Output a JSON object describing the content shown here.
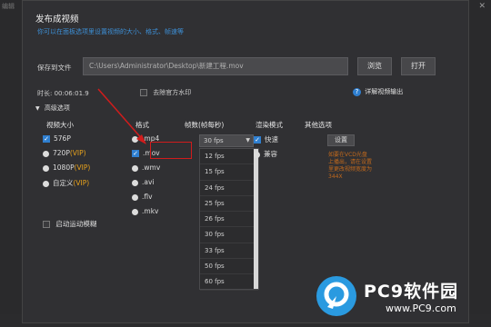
{
  "background": {
    "left_label": "编辑"
  },
  "dialog": {
    "title": "发布成视频",
    "subtitle": "你可以在面板选项里设置视频的大小、格式、帧速等",
    "save_label": "保存到文件",
    "path_value": "C:\\Users\\Administrator\\Desktop\\新建工程.mov",
    "browse_label": "浏览",
    "open_label": "打开",
    "duration": "时长: 00:06:01.9",
    "watermark_label": "去除官方水印",
    "help_label": "详解视频输出",
    "advanced_label": "高级选项",
    "columns": {
      "size": "视频大小",
      "format": "格式",
      "fps": "帧数(帧每秒)",
      "render": "渲染模式",
      "other": "其他选项"
    },
    "sizes": [
      {
        "label": "576P",
        "vip": "",
        "selected": true
      },
      {
        "label": "720P",
        "vip": "(VIP)",
        "selected": false
      },
      {
        "label": "1080P",
        "vip": "(VIP)",
        "selected": false
      },
      {
        "label": "自定义",
        "vip": "(VIP)",
        "selected": false
      }
    ],
    "formats": [
      {
        "label": ".mp4",
        "selected": false
      },
      {
        "label": ".mov",
        "selected": true
      },
      {
        "label": ".wmv",
        "selected": false
      },
      {
        "label": ".avi",
        "selected": false
      },
      {
        "label": ".flv",
        "selected": false
      },
      {
        "label": ".mkv",
        "selected": false
      }
    ],
    "fps_selected": "30 fps",
    "fps_options": [
      "12 fps",
      "15 fps",
      "24 fps",
      "25 fps",
      "26 fps",
      "30 fps",
      "33 fps",
      "50 fps",
      "60 fps"
    ],
    "render_modes": [
      {
        "label": "快速",
        "selected": true
      },
      {
        "label": "兼容",
        "selected": false
      }
    ],
    "settings_label": "设置",
    "note": "如要在VCD光盘上播出，请在设置里更改视频宽度为344X",
    "motion_blur_label": "启动运动模糊"
  },
  "logo": {
    "name": "PC9软件园",
    "url": "www.PC9.com"
  },
  "colors": {
    "accent": "#2f7fd0",
    "vip": "#e8a21c",
    "highlight": "#d11c1c"
  }
}
